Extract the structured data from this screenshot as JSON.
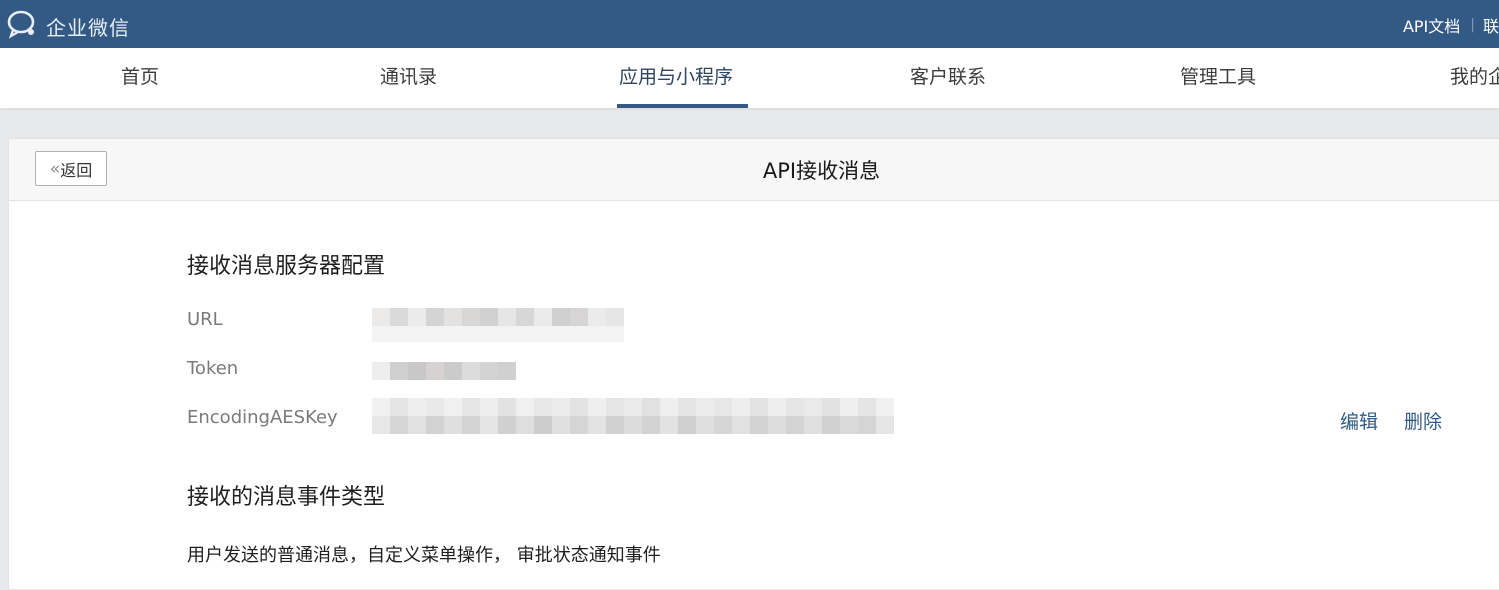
{
  "header": {
    "logo_text": "企业微信",
    "links": {
      "api_docs": "API文档",
      "separator": "|",
      "cut_off": "联"
    }
  },
  "nav": {
    "tabs": [
      {
        "label": "首页",
        "active": false
      },
      {
        "label": "通讯录",
        "active": false
      },
      {
        "label": "应用与小程序",
        "active": true
      },
      {
        "label": "客户联系",
        "active": false
      },
      {
        "label": "管理工具",
        "active": false
      },
      {
        "label": "我的企业",
        "active": false
      }
    ]
  },
  "page": {
    "back_label": "返回",
    "title": "API接收消息"
  },
  "server_config": {
    "title": "接收消息服务器配置",
    "fields": [
      {
        "label": "URL",
        "value_state": "redacted"
      },
      {
        "label": "Token",
        "value_state": "redacted"
      },
      {
        "label": "EncodingAESKey",
        "value_state": "redacted"
      }
    ],
    "actions": {
      "edit": "编辑",
      "delete": "删除"
    }
  },
  "events": {
    "title": "接收的消息事件类型",
    "description": "用户发送的普通消息，自定义菜单操作， 审批状态通知事件"
  },
  "colors": {
    "topbar": "#335a84",
    "accent": "#335a84",
    "background": "#e8e9eb"
  }
}
